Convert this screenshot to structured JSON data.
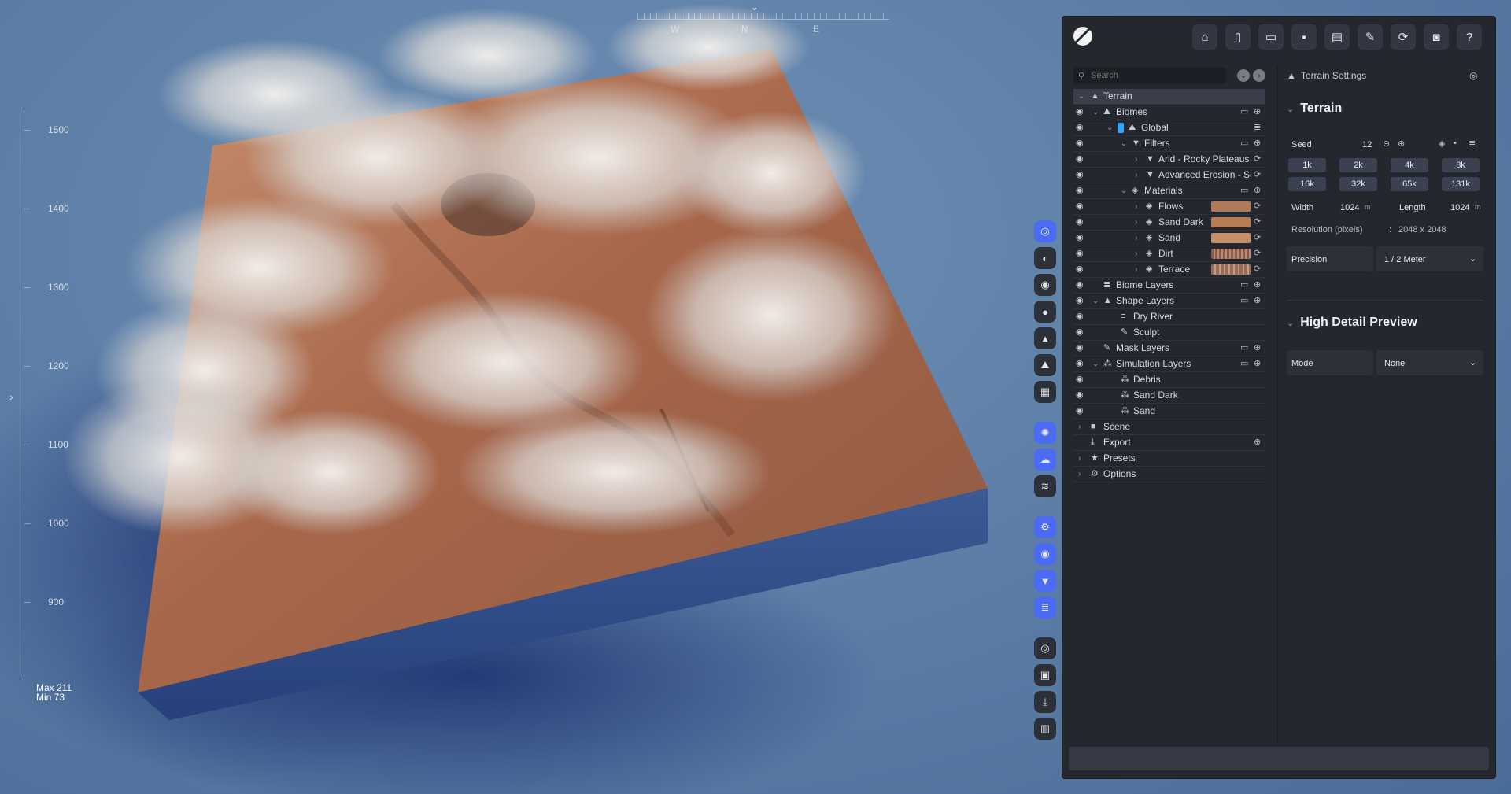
{
  "compass": {
    "w": "W",
    "n": "N",
    "e": "E"
  },
  "ruler": {
    "labels": [
      "1500",
      "1400",
      "1300",
      "1200",
      "1100",
      "1000",
      "900"
    ],
    "max": "Max 211",
    "min": "Min 73"
  },
  "toolbar": {
    "icons": [
      "home-icon",
      "new-file-icon",
      "open-folder-icon",
      "save-icon",
      "save-as-icon",
      "export-icon",
      "refresh-icon",
      "camera-icon",
      "help-icon"
    ]
  },
  "tree": {
    "search_placeholder": "Search",
    "items": [
      {
        "label": "Terrain"
      },
      {
        "label": "Biomes"
      },
      {
        "label": "Global"
      },
      {
        "label": "Filters"
      },
      {
        "label": "Arid - Rocky Plateaus"
      },
      {
        "label": "Advanced Erosion - Sc"
      },
      {
        "label": "Materials"
      },
      {
        "label": "Flows",
        "color": "#b07a5a"
      },
      {
        "label": "Sand Dark",
        "color": "#b77b55"
      },
      {
        "label": "Sand",
        "color": "#c58f6a"
      },
      {
        "label": "Dirt",
        "color": "#8a5a48"
      },
      {
        "label": "Terrace",
        "color": "#9a6c57"
      },
      {
        "label": "Biome Layers"
      },
      {
        "label": "Shape Layers"
      },
      {
        "label": "Dry River"
      },
      {
        "label": "Sculpt"
      },
      {
        "label": "Mask Layers"
      },
      {
        "label": "Simulation Layers"
      },
      {
        "label": "Debris"
      },
      {
        "label": "Sand Dark"
      },
      {
        "label": "Sand"
      },
      {
        "label": "Scene"
      },
      {
        "label": "Export"
      },
      {
        "label": "Presets"
      },
      {
        "label": "Options"
      }
    ]
  },
  "props": {
    "header": "Terrain Settings",
    "terrain_title": "Terrain",
    "seed_label": "Seed",
    "seed_value": "12",
    "res_chips": [
      "1k",
      "2k",
      "4k",
      "8k",
      "16k",
      "32k",
      "65k",
      "131k"
    ],
    "width_label": "Width",
    "width_value": "1024",
    "width_unit": "m",
    "length_label": "Length",
    "length_value": "1024",
    "length_unit": "m",
    "resolution_label": "Resolution (pixels)",
    "resolution_sep": ":",
    "resolution_value": "2048 x 2048",
    "precision_label": "Precision",
    "precision_value": "1 / 2 Meter",
    "hd_title": "High Detail Preview",
    "mode_label": "Mode",
    "mode_value": "None"
  }
}
